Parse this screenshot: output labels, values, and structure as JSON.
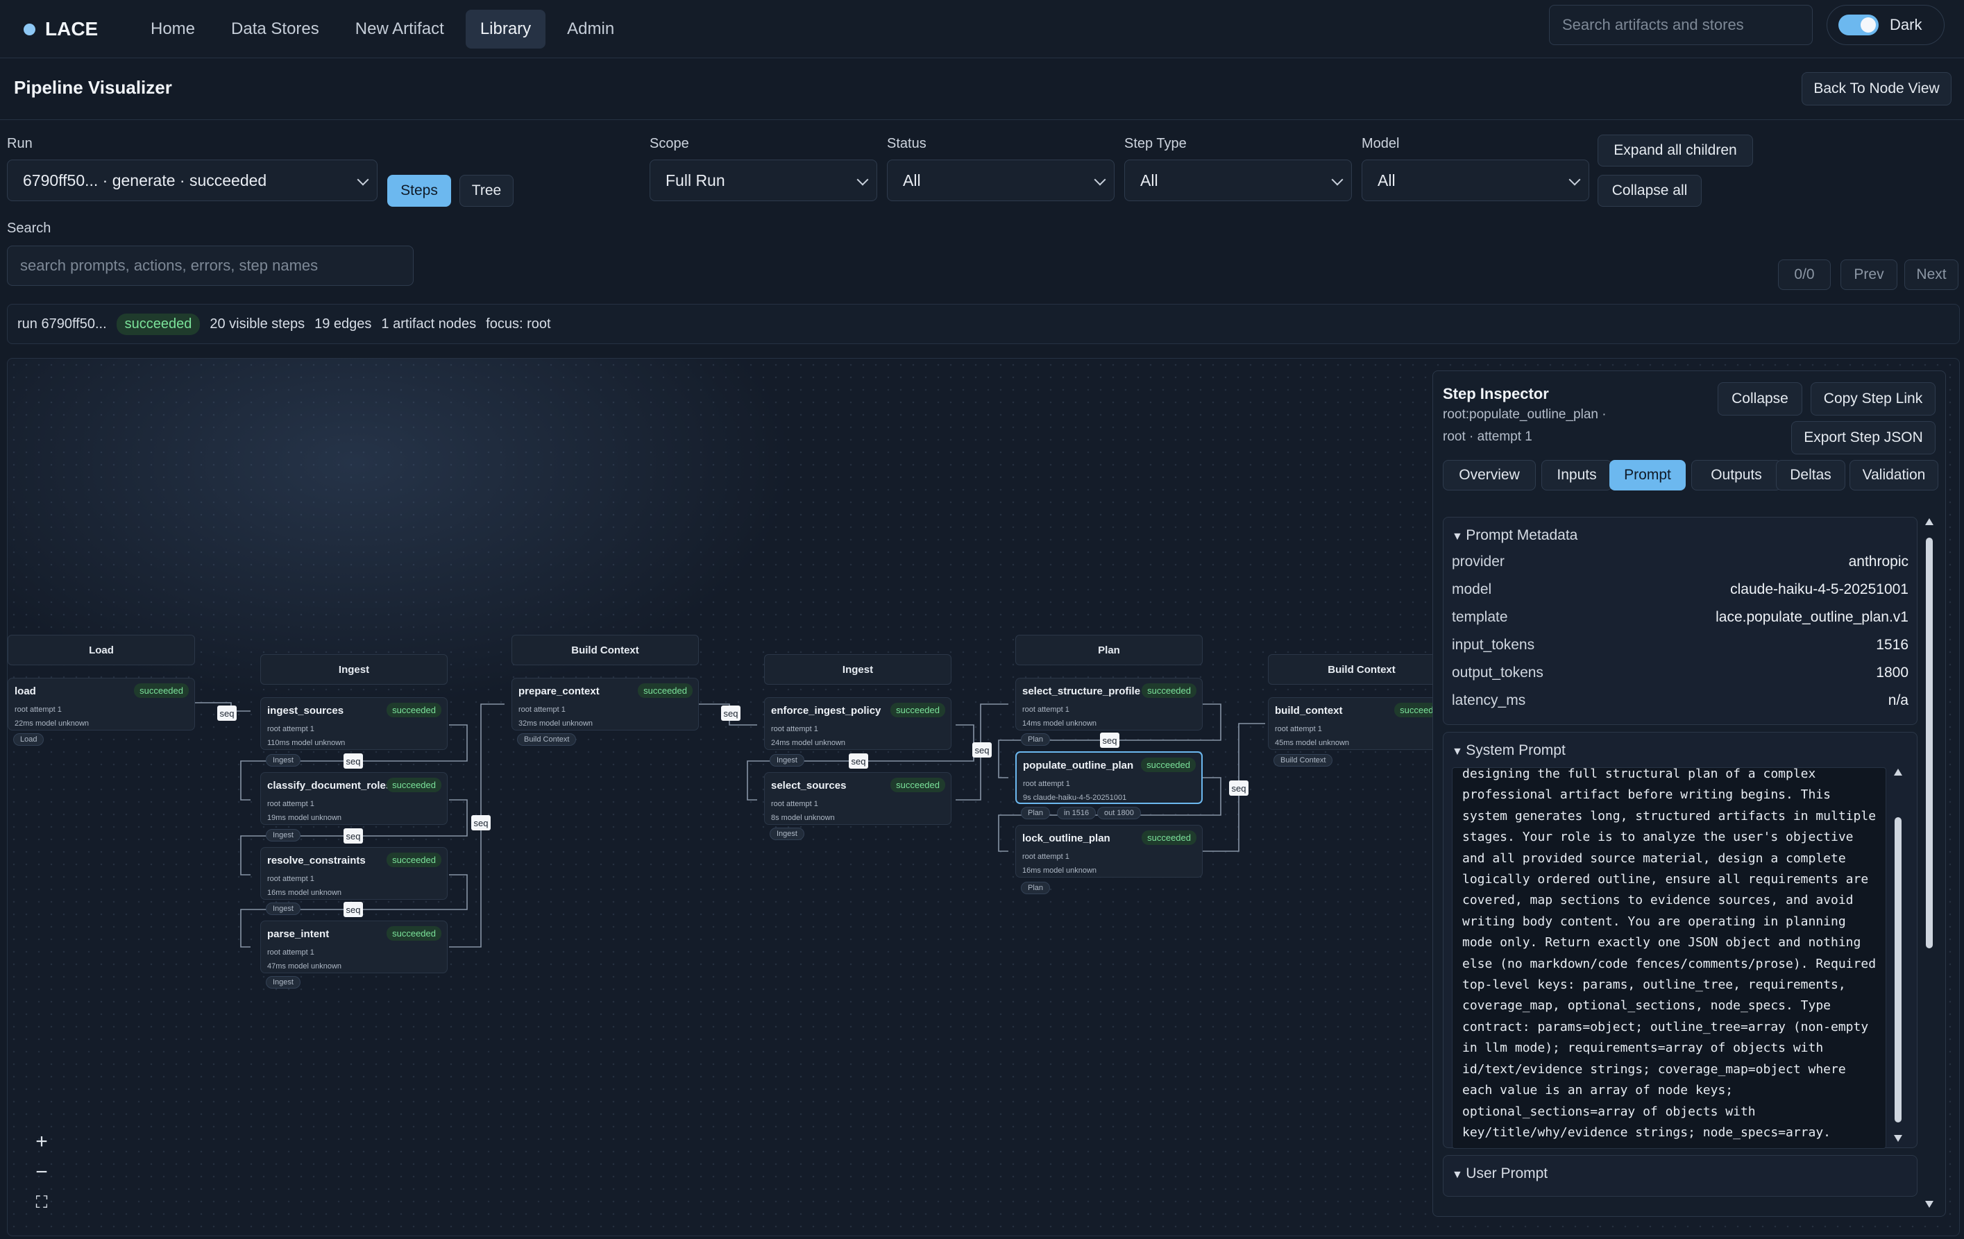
{
  "nav": {
    "brand": "LACE",
    "links": [
      {
        "label": "Home",
        "active": false
      },
      {
        "label": "Data Stores",
        "active": false
      },
      {
        "label": "New Artifact",
        "active": false
      },
      {
        "label": "Library",
        "active": true
      },
      {
        "label": "Admin",
        "active": false
      }
    ],
    "search_placeholder": "Search artifacts and stores",
    "theme_label": "Dark"
  },
  "page": {
    "title": "Pipeline Visualizer",
    "back_label": "Back To Node View"
  },
  "filters": {
    "run_label": "Run",
    "run_value": "6790ff50... · generate · succeeded",
    "view_modes": [
      "Steps",
      "Tree"
    ],
    "scope_label": "Scope",
    "scope_value": "Full Run",
    "status_label": "Status",
    "status_value": "All",
    "steptype_label": "Step Type",
    "steptype_value": "All",
    "model_label": "Model",
    "model_value": "All",
    "expand_label": "Expand all children",
    "collapse_label": "Collapse all",
    "search_label": "Search",
    "search_placeholder": "search prompts, actions, errors, step names",
    "match_count": "0/0",
    "prev_label": "Prev",
    "next_label": "Next"
  },
  "summary": {
    "run": "run 6790ff50...",
    "status": "succeeded",
    "visible_steps": "20 visible steps",
    "edges": "19 edges",
    "artifact_nodes": "1 artifact nodes",
    "focus": "focus: root"
  },
  "graph": {
    "stages": [
      "Load",
      "Ingest",
      "Build Context",
      "Ingest",
      "Plan",
      "Build Context"
    ],
    "nodes": [
      {
        "name": "load",
        "status": "succeeded",
        "meta": "root    attempt 1",
        "stats": "22ms    model unknown",
        "tag": "Load"
      },
      {
        "name": "ingest_sources",
        "status": "succeeded",
        "meta": "root    attempt 1",
        "stats": "110ms    model unknown",
        "tag": "Ingest"
      },
      {
        "name": "classify_document_roles",
        "status": "succeeded",
        "meta": "root    attempt 1",
        "stats": "19ms    model unknown",
        "tag": "Ingest"
      },
      {
        "name": "resolve_constraints",
        "status": "succeeded",
        "meta": "root    attempt 1",
        "stats": "16ms    model unknown",
        "tag": "Ingest"
      },
      {
        "name": "parse_intent",
        "status": "succeeded",
        "meta": "root    attempt 1",
        "stats": "47ms    model unknown",
        "tag": "Ingest"
      },
      {
        "name": "prepare_context",
        "status": "succeeded",
        "meta": "root    attempt 1",
        "stats": "32ms    model unknown",
        "tag": "Build Context"
      },
      {
        "name": "enforce_ingest_policy",
        "status": "succeeded",
        "meta": "root    attempt 1",
        "stats": "24ms    model unknown",
        "tag": "Ingest"
      },
      {
        "name": "select_sources",
        "status": "succeeded",
        "meta": "root    attempt 1",
        "stats": "8s    model unknown",
        "tag": "Ingest"
      },
      {
        "name": "select_structure_profile",
        "status": "succeeded",
        "meta": "root    attempt 1",
        "stats": "14ms    model unknown",
        "tag": "Plan"
      },
      {
        "name": "populate_outline_plan",
        "status": "succeeded",
        "meta": "root    attempt 1",
        "stats": "9s    claude-haiku-4-5-20251001",
        "tag": "Plan",
        "tokens_in": "in 1516",
        "tokens_out": "out 1800"
      },
      {
        "name": "lock_outline_plan",
        "status": "succeeded",
        "meta": "root    attempt 1",
        "stats": "16ms    model unknown",
        "tag": "Plan"
      },
      {
        "name": "build_context",
        "status": "succeeded",
        "meta": "root    attempt 1",
        "stats": "45ms    model unknown",
        "tag": "Build Context"
      }
    ],
    "edge_label": "seq",
    "zoom_in": "+",
    "zoom_out": "−",
    "fit": "⛶"
  },
  "inspector": {
    "title": "Step Inspector",
    "path_line1": "root:populate_outline_plan ·",
    "path_line2": "root · attempt 1",
    "collapse_label": "Collapse",
    "copy_label": "Copy Step Link",
    "export_label": "Export Step JSON",
    "tabs": [
      {
        "label": "Overview",
        "active": false
      },
      {
        "label": "Inputs",
        "active": false
      },
      {
        "label": "Prompt",
        "active": true
      },
      {
        "label": "Outputs",
        "active": false
      },
      {
        "label": "Deltas",
        "active": false
      },
      {
        "label": "Validation",
        "active": false
      }
    ],
    "metadata_title": "Prompt Metadata",
    "metadata": [
      {
        "key": "provider",
        "value": "anthropic"
      },
      {
        "key": "model",
        "value": "claude-haiku-4-5-20251001"
      },
      {
        "key": "template",
        "value": "lace.populate_outline_plan.v1"
      },
      {
        "key": "input_tokens",
        "value": "1516"
      },
      {
        "key": "output_tokens",
        "value": "1800"
      },
      {
        "key": "latency_ms",
        "value": "n/a"
      }
    ],
    "system_prompt_title": "System Prompt",
    "system_prompt": "designing the full structural plan of a complex professional artifact before writing begins. This system generates long, structured artifacts in multiple stages. Your role is to analyze the user's objective and all provided source material, design a complete logically ordered outline, ensure all requirements are covered, map sections to evidence sources, and avoid writing body content. You are operating in planning mode only. Return exactly one JSON object and nothing else (no markdown/code fences/comments/prose). Required top-level keys: params, outline_tree, requirements, coverage_map, optional_sections, node_specs. Type contract: params=object; outline_tree=array (non-empty in llm mode); requirements=array of objects with id/text/evidence strings; coverage_map=object where each value is an array of node keys; optional_sections=array of objects with key/title/why/evidence strings; node_specs=array.",
    "user_prompt_title": "User Prompt"
  }
}
